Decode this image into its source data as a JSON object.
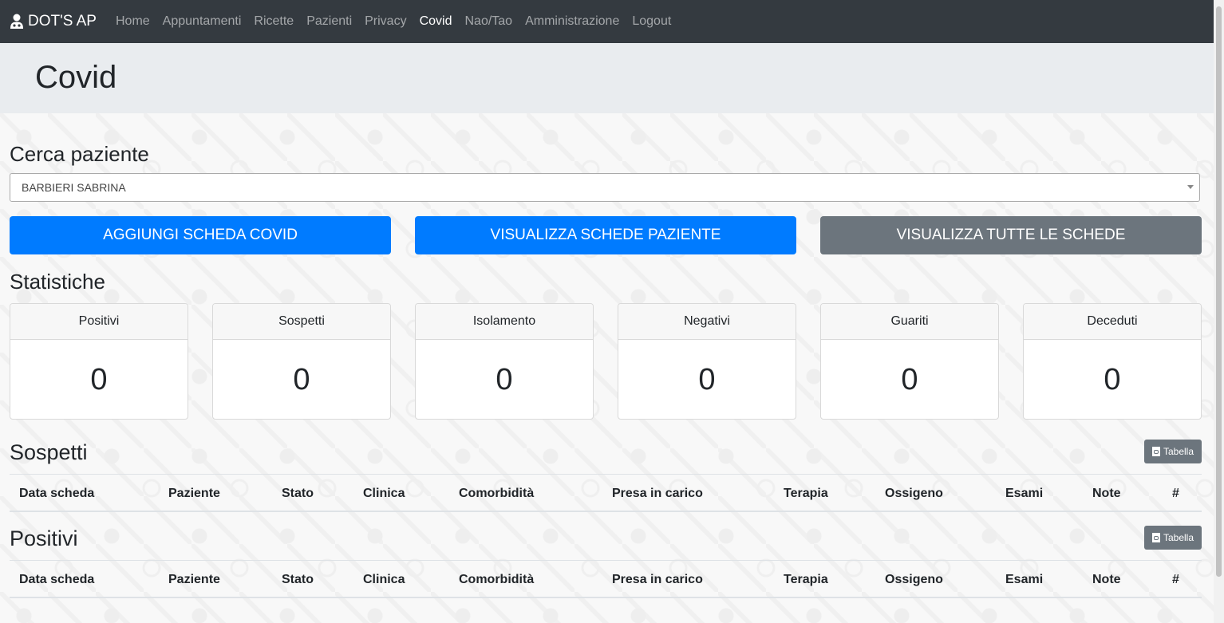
{
  "navbar": {
    "brand": "DOT'S AP",
    "items": [
      "Home",
      "Appuntamenti",
      "Ricette",
      "Pazienti",
      "Privacy",
      "Covid",
      "Nao/Tao",
      "Amministrazione",
      "Logout"
    ],
    "active_item": "Covid"
  },
  "page_title": "Covid",
  "search": {
    "title": "Cerca paziente",
    "selected": "BARBIERI SABRINA"
  },
  "buttons": {
    "add": "AGGIUNGI SCHEDA COVID",
    "view_patient": "VISUALIZZA SCHEDE PAZIENTE",
    "view_all": "VISUALIZZA TUTTE LE SCHEDE"
  },
  "stats": {
    "title": "Statistiche",
    "cards": [
      {
        "label": "Positivi",
        "value": "0"
      },
      {
        "label": "Sospetti",
        "value": "0"
      },
      {
        "label": "Isolamento",
        "value": "0"
      },
      {
        "label": "Negativi",
        "value": "0"
      },
      {
        "label": "Guariti",
        "value": "0"
      },
      {
        "label": "Deceduti",
        "value": "0"
      }
    ]
  },
  "sections": [
    {
      "title": "Sospetti",
      "pdf_label": "Tabella"
    },
    {
      "title": "Positivi",
      "pdf_label": "Tabella"
    }
  ],
  "table_columns": [
    "Data scheda",
    "Paziente",
    "Stato",
    "Clinica",
    "Comorbidità",
    "Presa in carico",
    "Terapia",
    "Ossigeno",
    "Esami",
    "Note",
    "#"
  ],
  "colors": {
    "primary": "#007bff",
    "secondary": "#6c757d",
    "navbar": "#343a40",
    "jumbotron": "#e9ecef"
  }
}
